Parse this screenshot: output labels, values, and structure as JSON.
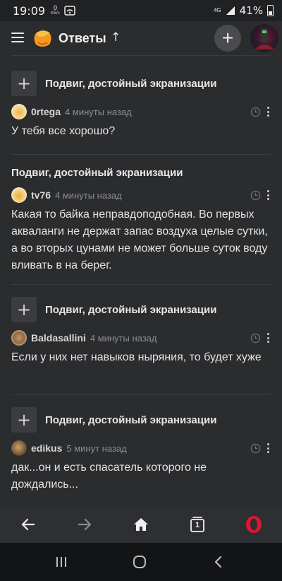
{
  "status_bar": {
    "time": "19:09",
    "net_speed": "0",
    "net_unit": "KB/s",
    "network": "4G",
    "battery": "41%"
  },
  "header": {
    "title": "Ответы",
    "add_label": "+"
  },
  "feed": {
    "items": [
      {
        "title": "Подвиг, достойный экранизации",
        "author": "0rtega",
        "time": "4 минуты назад",
        "text": "У тебя все хорошо?"
      },
      {
        "title": "Подвиг, достойный экранизации",
        "author": "tv76",
        "time": "4 минуты назад",
        "text": "Какая то байка неправдоподобная. Во первых акваланги не держат запас воздуха целые сутки, а во вторых цунами не может больше суток воду вливать в на берег."
      },
      {
        "title": "Подвиг, достойный экранизации",
        "author": "Baldasallini",
        "time": "4 минуты назад",
        "text": "Если у них нет навыков ныряния, то будет хуже"
      },
      {
        "title": "Подвиг, достойный экранизации",
        "author": "edikus",
        "time": "5 минут назад",
        "text": "дак...он и есть спасатель которого не дождались..."
      }
    ]
  },
  "browser_bar": {
    "tabs_count": "1"
  },
  "colors": {
    "background": "#2b2c2e",
    "status_bar": "#202123",
    "browser_bar": "#2e2f33",
    "nav_bar": "#131416",
    "opera_red": "#e1152e"
  },
  "icons": [
    "menu-icon",
    "logo-icon",
    "arrow-up-icon",
    "plus-icon",
    "clock-icon",
    "more-vert-icon",
    "arrow-left-icon",
    "arrow-right-icon",
    "home-icon",
    "tabs-icon",
    "opera-icon",
    "recents-icon",
    "home-nav-icon",
    "back-nav-icon"
  ]
}
